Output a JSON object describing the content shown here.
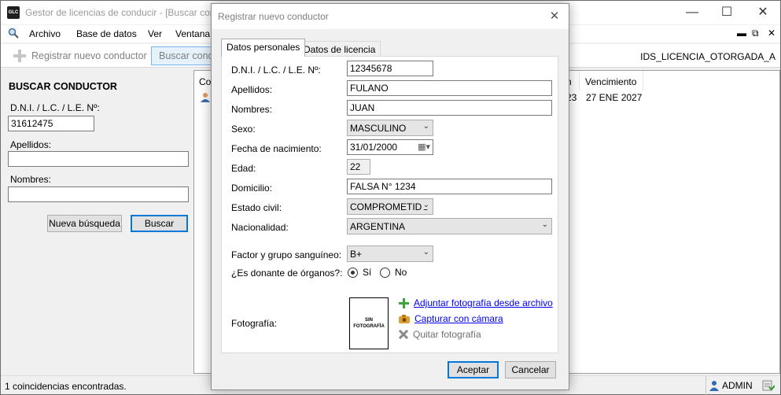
{
  "window": {
    "icon_text": "GLC",
    "title": "Gestor de licencias de conducir - [Buscar conductor]",
    "controls": [
      "minimize-icon",
      "maximize-icon",
      "close-icon"
    ]
  },
  "menu": {
    "items": [
      "Archivo",
      "Base de datos",
      "Ver",
      "Ventana"
    ]
  },
  "toolbar": {
    "register_label": "Registrar nuevo conductor",
    "search_label": "Buscar conductor",
    "right_text": "IDS_LICENCIA_OTORGADA_A"
  },
  "search_panel": {
    "title": "BUSCAR CONDUCTOR",
    "dni_label": "D.N.I. / L.C. / L.E. Nº:",
    "dni_value": "31612475",
    "apellidos_label": "Apellidos:",
    "apellidos_value": "",
    "nombres_label": "Nombres:",
    "nombres_value": "",
    "new_search_button": "Nueva búsqueda",
    "search_button": "Buscar"
  },
  "results": {
    "headers": [
      "Conductor",
      "Otorgamiento",
      "Vencimiento"
    ],
    "header_visible_fragments": [
      "Co",
      "n"
    ],
    "rows": [
      {
        "otorgamiento_fragment": "23",
        "vencimiento": "27 ENE 2027"
      }
    ]
  },
  "status": {
    "text": "1 coincidencias encontradas.",
    "user": "ADMIN"
  },
  "dialog": {
    "title": "Registrar nuevo conductor",
    "tabs": [
      "Datos personales",
      "Datos de licencia"
    ],
    "active_tab": "Datos personales",
    "fields": {
      "dni_label": "D.N.I. / L.C. / L.E. Nº:",
      "dni": "12345678",
      "apellidos_label": "Apellidos:",
      "apellidos": "FULANO",
      "nombres_label": "Nombres:",
      "nombres": "JUAN",
      "sexo_label": "Sexo:",
      "sexo": "MASCULINO",
      "fecha_label": "Fecha de nacimiento:",
      "fecha": "31/01/2000",
      "edad_label": "Edad:",
      "edad": "22",
      "domicilio_label": "Domicilio:",
      "domicilio": "FALSA N° 1234",
      "estado_civil_label": "Estado civil:",
      "estado_civil": "COMPROMETIDO",
      "nacionalidad_label": "Nacionalidad:",
      "nacionalidad": "ARGENTINA",
      "sangre_label": "Factor y grupo sanguíneo:",
      "sangre": "B+",
      "donante_label": "¿Es donante de órganos?:",
      "donante_si": "Sí",
      "donante_no": "No",
      "donante_selected": "Sí",
      "foto_label": "Fotografía:",
      "foto_placeholder_line1": "SIN",
      "foto_placeholder_line2": "FOTOGRAFÍA",
      "foto_add": "Adjuntar fotografía desde archivo",
      "foto_camera": "Capturar con cámara",
      "foto_remove": "Quitar fotografía"
    },
    "accept": "Aceptar",
    "cancel": "Cancelar"
  }
}
